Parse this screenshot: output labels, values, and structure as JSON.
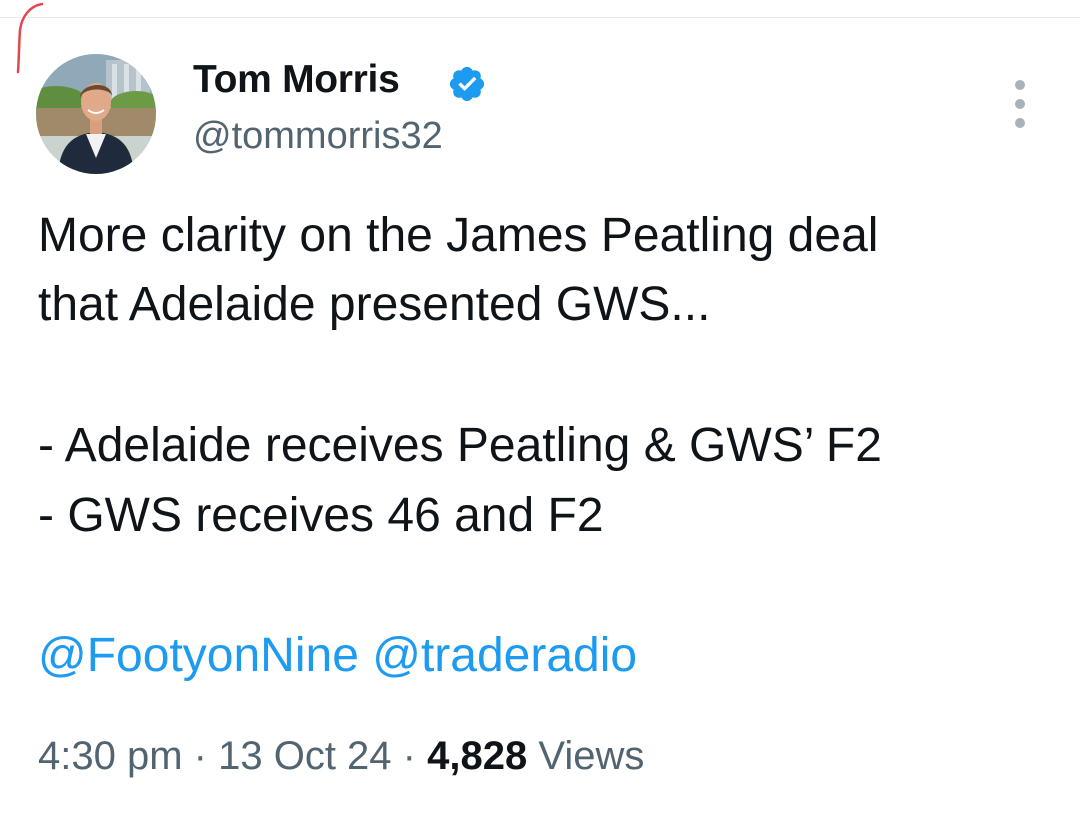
{
  "author": {
    "name": "Tom Morris",
    "handle": "@tommorris32",
    "verified_color": "#1d9bf0"
  },
  "icons": {
    "verified": "verified-badge-icon",
    "more": "more-options-icon"
  },
  "tweet": {
    "lines": [
      "More clarity on the James Peatling deal",
      "that Adelaide presented GWS...",
      "- Adelaide receives Peatling & GWS’ F2",
      "- GWS receives 46 and F2"
    ],
    "mentions": [
      "@FootyonNine",
      "@traderadio"
    ]
  },
  "meta": {
    "time": "4:30 pm",
    "date": "13 Oct 24",
    "separator": "·",
    "views_count": "4,828",
    "views_label": "Views"
  },
  "colors": {
    "text": "#0f1419",
    "secondary": "#536471",
    "link": "#1d9bf0"
  }
}
